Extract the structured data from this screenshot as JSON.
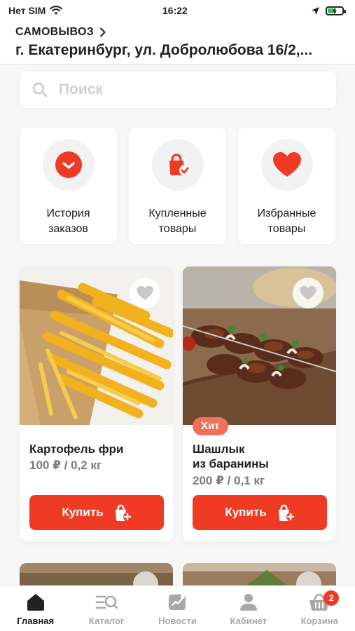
{
  "status_bar": {
    "carrier": "Нет SIM",
    "time": "16:22",
    "battery_level": 0.6
  },
  "header": {
    "delivery_mode": "САМОВЫВОЗ",
    "address": "г. Екатеринбург, ул. Добролюбова 16/2,..."
  },
  "search": {
    "placeholder": "Поиск"
  },
  "quick_links": [
    {
      "line1": "История",
      "line2": "заказов",
      "icon": "order-history-icon"
    },
    {
      "line1": "Купленные",
      "line2": "товары",
      "icon": "purchased-icon"
    },
    {
      "line1": "Избранные",
      "line2": "товары",
      "icon": "heart-icon"
    }
  ],
  "products": [
    {
      "title_line1": "Картофель фри",
      "title_line2": "",
      "price": "100 ₽ / 0,2 кг",
      "badge": "",
      "buy_label": "Купить"
    },
    {
      "title_line1": "Шашлык",
      "title_line2": "из баранины",
      "price": "200 ₽ / 0,1 кг",
      "badge": "Хит",
      "buy_label": "Купить"
    }
  ],
  "tabbar": {
    "items": [
      {
        "label": "Главная",
        "icon": "home-icon",
        "active": true
      },
      {
        "label": "Каталог",
        "icon": "catalog-icon",
        "active": false
      },
      {
        "label": "Новости",
        "icon": "news-icon",
        "active": false
      },
      {
        "label": "Кабинет",
        "icon": "profile-icon",
        "active": false
      },
      {
        "label": "Корзина",
        "icon": "basket-icon",
        "active": false
      }
    ],
    "cart_count": "2"
  },
  "colors": {
    "accent": "#ef3b24",
    "badge": "#f0705a",
    "price": "#7a7a7a"
  }
}
